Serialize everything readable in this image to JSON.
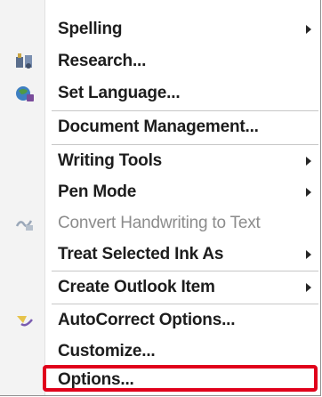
{
  "menu": {
    "items": [
      {
        "label": "Spelling",
        "submenu": true,
        "disabled": false,
        "icon": ""
      },
      {
        "label": "Research...",
        "submenu": false,
        "disabled": false,
        "icon": "research-icon"
      },
      {
        "label": "Set Language...",
        "submenu": false,
        "disabled": false,
        "icon": "set-language-icon"
      },
      {
        "label": "Document Management...",
        "submenu": false,
        "disabled": false,
        "icon": ""
      },
      {
        "label": "Writing Tools",
        "submenu": true,
        "disabled": false,
        "icon": ""
      },
      {
        "label": "Pen Mode",
        "submenu": true,
        "disabled": false,
        "icon": ""
      },
      {
        "label": "Convert Handwriting to Text",
        "submenu": false,
        "disabled": true,
        "icon": "convert-handwriting-icon"
      },
      {
        "label": "Treat Selected Ink As",
        "submenu": true,
        "disabled": false,
        "icon": ""
      },
      {
        "label": "Create Outlook Item",
        "submenu": true,
        "disabled": false,
        "icon": ""
      },
      {
        "label": "AutoCorrect Options...",
        "submenu": false,
        "disabled": false,
        "icon": "autocorrect-icon"
      },
      {
        "label": "Customize...",
        "submenu": false,
        "disabled": false,
        "icon": ""
      },
      {
        "label": "Options...",
        "submenu": false,
        "disabled": false,
        "icon": "",
        "highlighted": true
      }
    ]
  },
  "colors": {
    "highlight_border": "#e0001b",
    "text": "#1d1d1d",
    "disabled_text": "#8c8c8c",
    "gutter": "#f3f3f3"
  }
}
